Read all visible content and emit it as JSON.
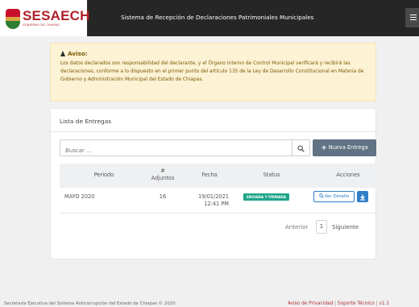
{
  "header": {
    "logo_text": "SESAECH",
    "logo_subtext": "GOBIERNO DE CHIAPAS",
    "title": "Sistema de Recepción de Declaraciones Patrimoniales Municipales",
    "menu_icon": "hamburger-icon"
  },
  "alert": {
    "title": "Aviso:",
    "icon": "warning-icon",
    "body": "Los datos declarados son responsabilidad del declarante, y el Órgano Interno de Control Municipal verificará y recibirá las declaraciones, conforme a lo dispuesto en el primer punto del artículo 135 de la Ley de Desarrollo Constitucional en Materia de Gobierno y Administración Municipal del Estado de Chiapas."
  },
  "list": {
    "title": "Lista de Entregas",
    "search_placeholder": "Buscar ...",
    "search_icon": "search-icon",
    "new_button": "Nueva Entrega",
    "new_button_icon": "plus-icon",
    "columns": {
      "periodo": "Periodo",
      "adjuntos_1": "#",
      "adjuntos_2": "Adjuntos",
      "fecha": "Fecha",
      "status": "Status",
      "acciones": "Acciones"
    },
    "rows": [
      {
        "periodo": "MAYO 2020",
        "adjuntos": "16",
        "fecha_1": "19/01/2021",
        "fecha_2": "12:41 PM",
        "status": "ENVIADA Y FIRMADA",
        "detail_button": "Ver Detalle",
        "detail_icon": "search-icon",
        "download_icon": "download-icon"
      }
    ],
    "pager": {
      "prev": "Anterior",
      "page": "1",
      "next": "Siguiente"
    }
  },
  "footer": {
    "left": "Secretaría Ejecutiva del Sistema Anticorrupción del Estado de Chiapas © 2020",
    "privacy": "Aviso de Privacidad",
    "support": "Soporte Técnico",
    "version": "v1.1",
    "separator": "|"
  },
  "colors": {
    "topbar": "#262626",
    "brand_red": "#b0202a",
    "alert_bg": "#fcf2d4",
    "primary_button": "#5f7384",
    "status_green": "#1fa58a",
    "link_blue": "#2f7fc8"
  }
}
